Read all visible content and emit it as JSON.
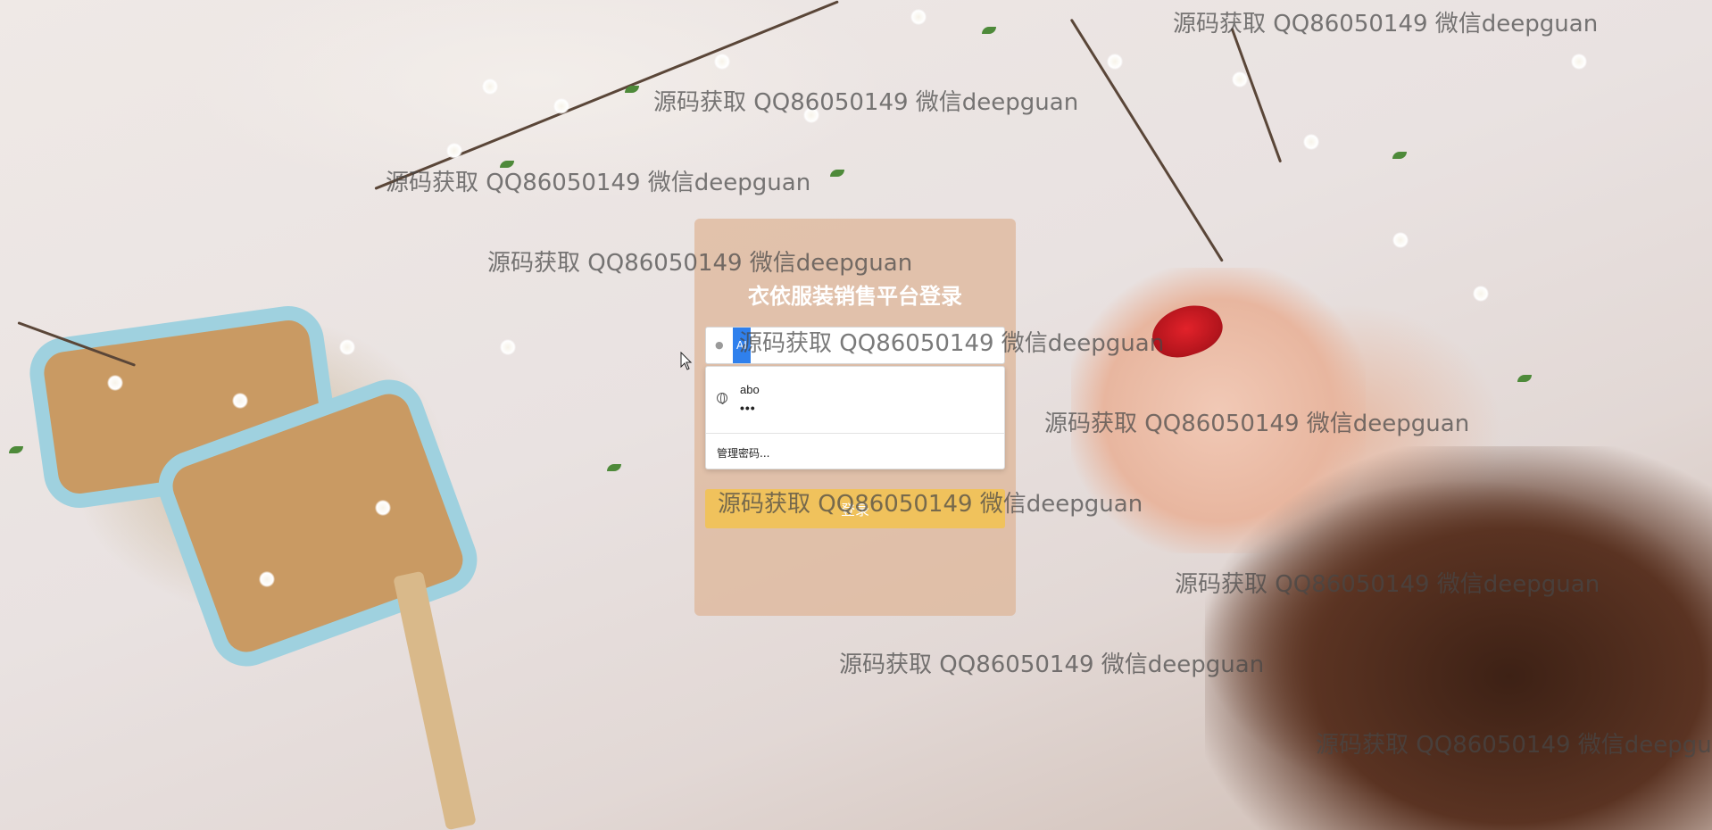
{
  "login": {
    "title": "衣依服装销售平台登录",
    "username_selected_text": "AI",
    "login_button_label": "登录"
  },
  "autofill": {
    "username": "abo",
    "password_mask": "•••",
    "manage_label": "管理密码..."
  },
  "watermark_text": "源码获取 QQ86050149 微信deepguan",
  "colors": {
    "panel": "#deb496",
    "button": "#f0c25c",
    "selection": "#2f80ed"
  }
}
